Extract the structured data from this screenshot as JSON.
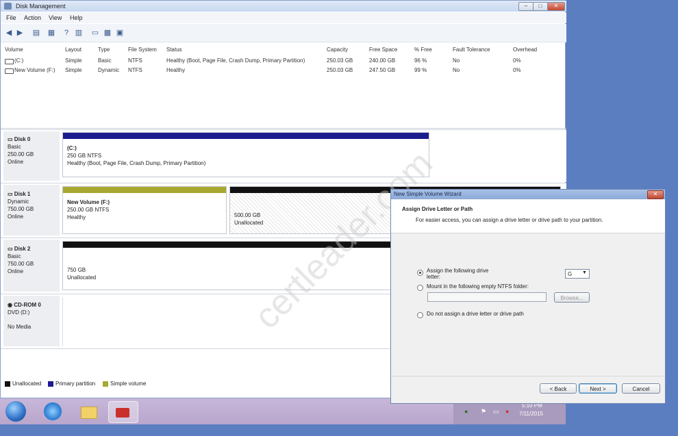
{
  "window": {
    "title": "Disk Management",
    "min": "–",
    "max": "□",
    "close": "✕"
  },
  "menu": [
    "File",
    "Action",
    "View",
    "Help"
  ],
  "volumes": {
    "headers": [
      "Volume",
      "Layout",
      "Type",
      "File System",
      "Status",
      "Capacity",
      "Free Space",
      "% Free",
      "Fault Tolerance",
      "Overhead"
    ],
    "rows": [
      [
        "(C:)",
        "Simple",
        "Basic",
        "NTFS",
        "Healthy (Boot, Page File, Crash Dump, Primary Partition)",
        "250.03 GB",
        "240.00 GB",
        "96 %",
        "No",
        "0%"
      ],
      [
        "New Volume (F:)",
        "Simple",
        "Dynamic",
        "NTFS",
        "Healthy",
        "250.03 GB",
        "247.50 GB",
        "99 %",
        "No",
        "0%"
      ]
    ]
  },
  "disks": [
    {
      "name": "Disk 0",
      "type": "Basic",
      "size": "250.00 GB",
      "status": "Online",
      "parts": [
        {
          "title": "(C:)",
          "line1": "250 GB NTFS",
          "line2": "Healthy (Boot, Page File, Crash Dump, Primary Partition)"
        }
      ]
    },
    {
      "name": "Disk 1",
      "type": "Dynamic",
      "size": "750.00 GB",
      "status": "Online",
      "parts": [
        {
          "title": "New Volume (F:)",
          "line1": "250.00 GB NTFS",
          "line2": "Healthy"
        },
        {
          "title": "",
          "line1": "500.00 GB",
          "line2": "Unallocated"
        }
      ]
    },
    {
      "name": "Disk 2",
      "type": "Basic",
      "size": "750.00 GB",
      "status": "Online",
      "parts": [
        {
          "title": "",
          "line1": "750 GB",
          "line2": "Unallocated"
        }
      ]
    },
    {
      "name": "CD-ROM 0",
      "type": "DVD (D:)",
      "size": "",
      "status": "No Media",
      "parts": []
    }
  ],
  "legend": [
    {
      "label": "Unallocated",
      "color": "#111111"
    },
    {
      "label": "Primary partition",
      "color": "#1c1c8f"
    },
    {
      "label": "Simple volume",
      "color": "#a8a830"
    }
  ],
  "colors": {
    "primary": "#1c1c8f",
    "simple": "#a8a830",
    "unallocated": "#111111"
  },
  "watermark": "certleader.com",
  "wizard": {
    "title": "New Simple Volume Wizard",
    "heading": "Assign Drive Letter or Path",
    "subheading": "For easier access, you can assign a drive letter or drive path to your partition.",
    "opt_assign": "Assign the following drive letter:",
    "drive_letter": "G",
    "opt_mount": "Mount in the following empty NTFS folder:",
    "browse": "Browse...",
    "opt_none": "Do not assign a drive letter or drive path",
    "back": "< Back",
    "next": "Next >",
    "cancel": "Cancel"
  },
  "clock": {
    "time": "5:10 PM",
    "date": "7/11/2015"
  }
}
